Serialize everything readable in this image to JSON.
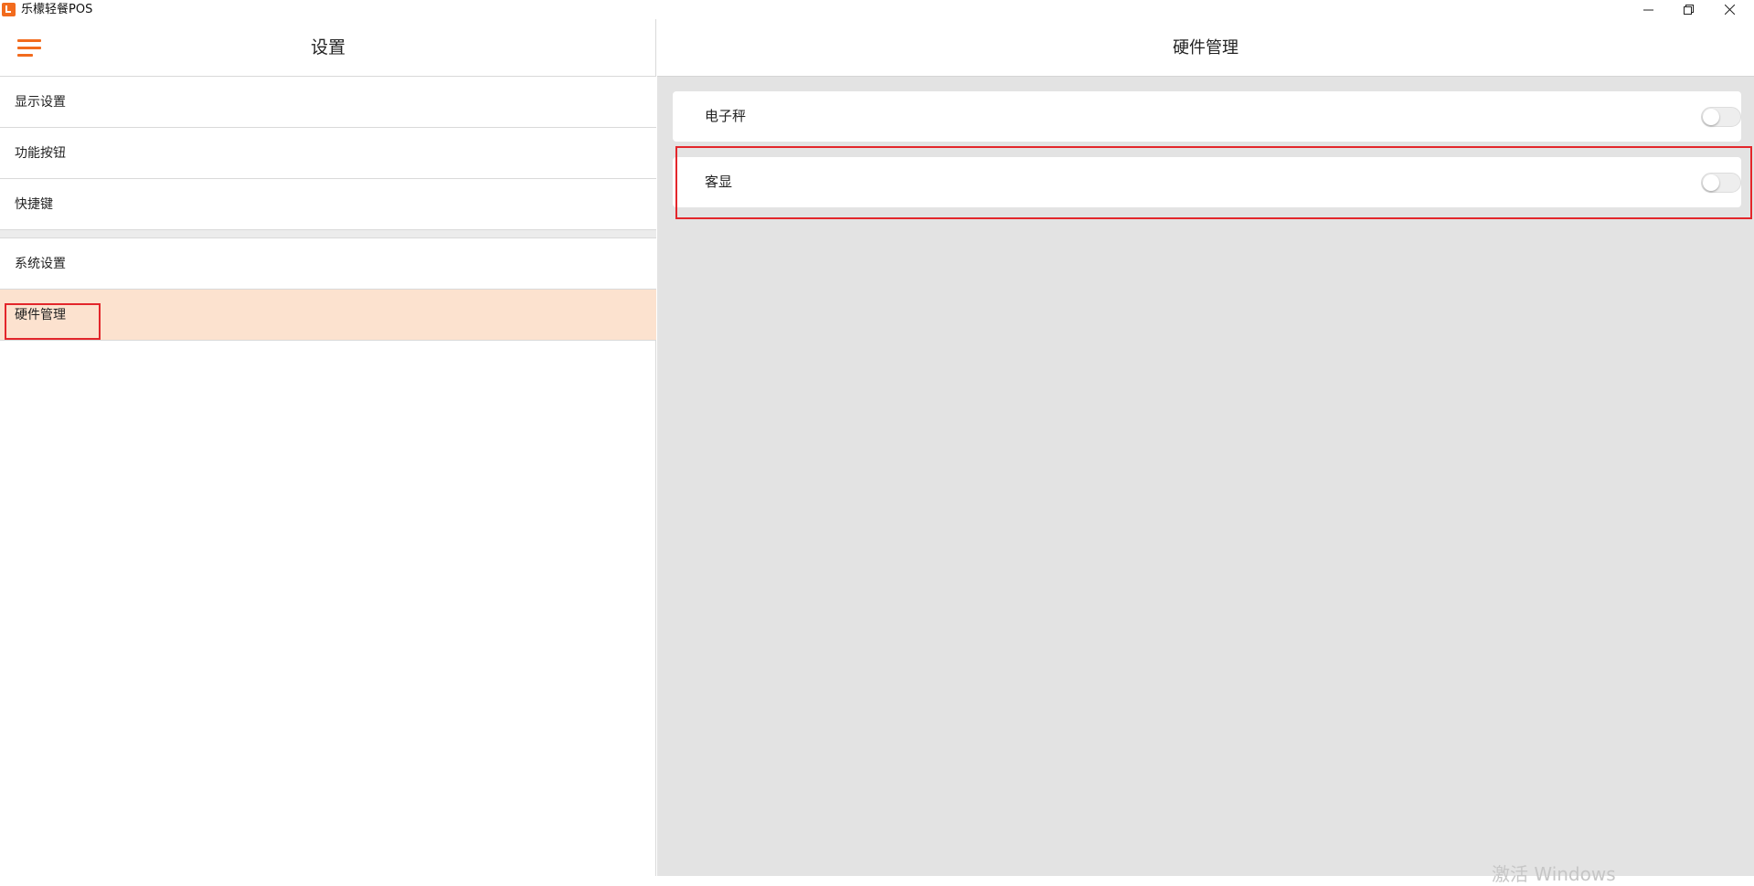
{
  "window": {
    "title": "乐檬轻餐POS",
    "minimize_label": "—",
    "maximize_label": "❐",
    "close_label": "✕"
  },
  "sidebar": {
    "header_title": "设置",
    "menu_icon": "hamburger-menu-icon",
    "items": [
      {
        "label": "显示设置",
        "active": false
      },
      {
        "label": "功能按钮",
        "active": false
      },
      {
        "label": "快捷键",
        "active": false
      },
      {
        "label": "系统设置",
        "active": false
      },
      {
        "label": "硬件管理",
        "active": true
      }
    ]
  },
  "main": {
    "header_title": "硬件管理",
    "settings": [
      {
        "label": "电子秤",
        "enabled": false
      },
      {
        "label": "客显",
        "enabled": false
      }
    ]
  },
  "watermark": {
    "text": "激活 Windows"
  },
  "colors": {
    "accent": "#f26b1d",
    "active_row_bg": "#fce2cf",
    "content_bg": "#e3e3e3",
    "annotation": "#e3262b"
  }
}
